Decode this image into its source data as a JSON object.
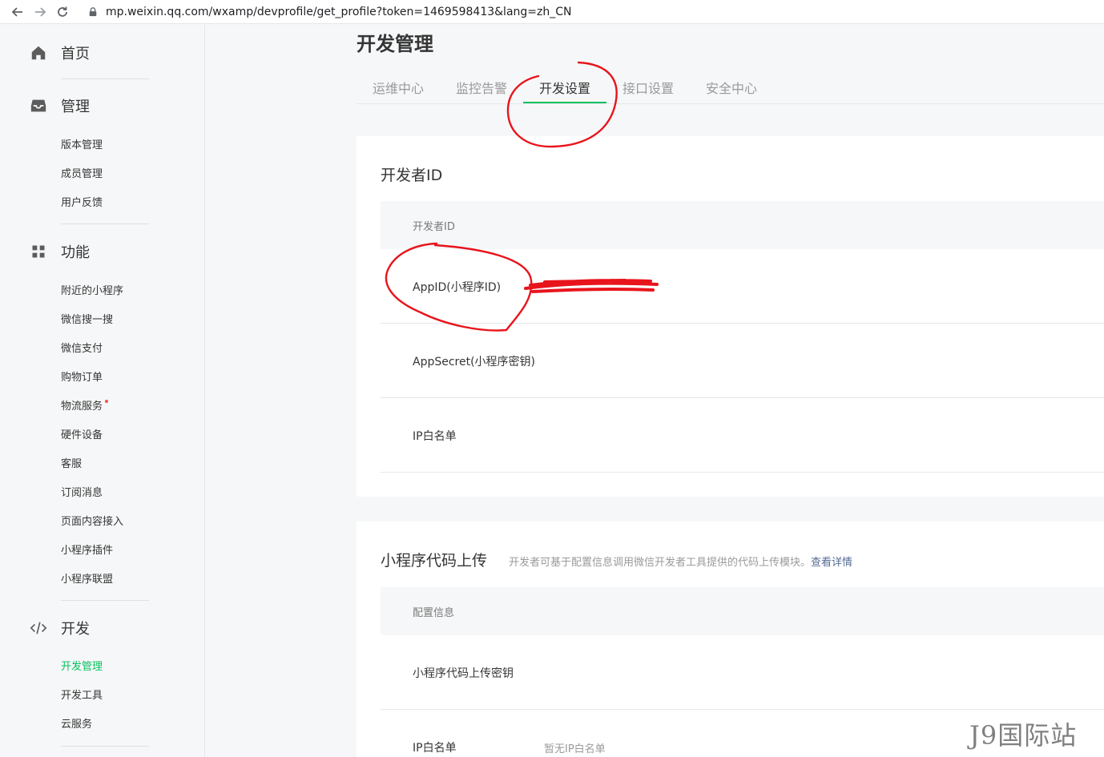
{
  "browser": {
    "url": "mp.weixin.qq.com/wxamp/devprofile/get_profile?token=1469598413&lang=zh_CN"
  },
  "sidebar": {
    "groups": [
      {
        "title": "首页",
        "icon": "home-icon",
        "items": []
      },
      {
        "title": "管理",
        "icon": "inbox-icon",
        "items": [
          "版本管理",
          "成员管理",
          "用户反馈"
        ]
      },
      {
        "title": "功能",
        "icon": "grid-icon",
        "items": [
          "附近的小程序",
          "微信搜一搜",
          "微信支付",
          "购物订单",
          "物流服务",
          "硬件设备",
          "客服",
          "订阅消息",
          "页面内容接入",
          "小程序插件",
          "小程序联盟"
        ]
      },
      {
        "title": "开发",
        "icon": "code-icon",
        "items": [
          "开发管理",
          "开发工具",
          "云服务"
        ]
      }
    ],
    "active_item": "开发管理"
  },
  "main": {
    "title": "开发管理",
    "tabs": [
      "运维中心",
      "监控告警",
      "开发设置",
      "接口设置",
      "安全中心"
    ],
    "active_tab": "开发设置",
    "developer_card": {
      "title": "开发者ID",
      "header": "开发者ID",
      "rows": [
        "AppID(小程序ID)",
        "AppSecret(小程序密钥)",
        "IP白名单"
      ]
    },
    "upload_card": {
      "title": "小程序代码上传",
      "desc": "开发者可基于配置信息调用微信开发者工具提供的代码上传模块。",
      "desc_link": "查看详情",
      "header": "配置信息",
      "rows": [
        {
          "label": "小程序代码上传密钥",
          "value": ""
        },
        {
          "label": "IP白名单",
          "value": "暂无IP白名单"
        }
      ]
    }
  },
  "watermark": "J9国际站",
  "colors": {
    "accent": "#07c160",
    "annotation": "#e8141c",
    "link": "#576b95"
  }
}
